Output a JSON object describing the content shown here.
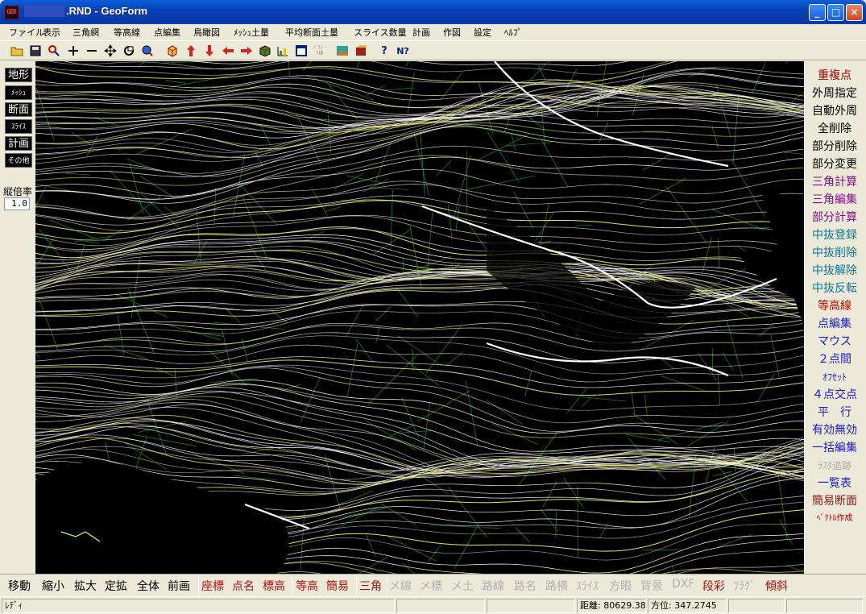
{
  "window": {
    "title": ".RND - GeoForm",
    "icon_text": "GEO",
    "buttons": {
      "minimize": "_",
      "maximize": "□",
      "close": "×"
    }
  },
  "menu": [
    "ファイル",
    "表示",
    "三角網",
    "等高線",
    "点編集",
    "鳥瞰図",
    "ﾒｯｼｭ土量",
    "平均断面土量",
    "スライス数量",
    "計画",
    "作図",
    "設定",
    "ﾍﾙﾌﾟ"
  ],
  "toolbar": [
    {
      "icon": "open-folder-icon"
    },
    {
      "icon": "save-icon"
    },
    {
      "icon": "zoom-icon"
    },
    {
      "icon": "plus-icon"
    },
    {
      "icon": "minus-icon"
    },
    {
      "icon": "move-icon"
    },
    {
      "icon": "rotate-icon"
    },
    {
      "icon": "zoom-refresh-icon"
    },
    {
      "icon": "cube-icon"
    },
    {
      "icon": "arrow-up-icon"
    },
    {
      "icon": "arrow-down-icon"
    },
    {
      "icon": "arrow-left-icon"
    },
    {
      "icon": "arrow-right-icon"
    },
    {
      "icon": "box-3d-icon"
    },
    {
      "icon": "chart-icon"
    },
    {
      "icon": "window-icon"
    },
    {
      "icon": "setting-disabled-icon",
      "label": "ﾊﾟﾗﾒ ｰﾀ確"
    },
    {
      "icon": "terrain-icon"
    },
    {
      "icon": "volume-icon"
    },
    {
      "icon": "help-icon",
      "label": "?"
    },
    {
      "icon": "context-help-icon",
      "label": "N?"
    }
  ],
  "left_panel": {
    "buttons": [
      "地形",
      "ﾒｯｼｭ",
      "断面",
      "ｽﾗｲｽ",
      "計画",
      "その他"
    ],
    "ratio_label": "縦倍率",
    "ratio_value": "1.0"
  },
  "right_panel": [
    {
      "label": "重複点",
      "color": "#a00000"
    },
    {
      "label": "外周指定",
      "color": "#000000"
    },
    {
      "label": "自動外周",
      "color": "#000000"
    },
    {
      "label": "全削除",
      "color": "#000000"
    },
    {
      "label": "部分削除",
      "color": "#000000"
    },
    {
      "label": "部分変更",
      "color": "#000000"
    },
    {
      "label": "三角計算",
      "color": "#8b0a8b"
    },
    {
      "label": "三角編集",
      "color": "#8b0a8b"
    },
    {
      "label": "部分計算",
      "color": "#8b0a8b"
    },
    {
      "label": "中抜登録",
      "color": "#0a7a9b"
    },
    {
      "label": "中抜削除",
      "color": "#0a7a9b"
    },
    {
      "label": "中抜解除",
      "color": "#0a7a9b"
    },
    {
      "label": "中抜反転",
      "color": "#0a7a9b"
    },
    {
      "label": "等高線",
      "color": "#c00000"
    },
    {
      "label": "点編集",
      "color": "#1a1acc"
    },
    {
      "label": "マウス",
      "color": "#1a1acc"
    },
    {
      "label": "２点間",
      "color": "#1a1acc"
    },
    {
      "label": "ｵﾌｾｯﾄ",
      "color": "#1a1acc"
    },
    {
      "label": "４点交点",
      "color": "#1a1acc"
    },
    {
      "label": "平　行",
      "color": "#1a1acc"
    },
    {
      "label": "有効無効",
      "color": "#1a1acc"
    },
    {
      "label": "一括編集",
      "color": "#1a1acc"
    },
    {
      "label": "ﾗｽﾀ追跡",
      "color": "#a8a8a8"
    },
    {
      "label": "一覧表",
      "color": "#1a1acc"
    },
    {
      "label": "簡易断面",
      "color": "#8b1a1a"
    },
    {
      "label": "ﾍﾞｸﾄﾙ作成",
      "color": "#c00000"
    }
  ],
  "bottom_bar": [
    {
      "label": "移動",
      "color": "#000000"
    },
    {
      "label": "縮小",
      "color": "#000000"
    },
    {
      "label": "拡大",
      "color": "#000000"
    },
    {
      "label": "定拡",
      "color": "#000000"
    },
    {
      "label": "全体",
      "color": "#000000"
    },
    {
      "label": "前画",
      "color": "#000000"
    },
    {
      "label": "座標",
      "color": "#b01010"
    },
    {
      "label": "点名",
      "color": "#b01010"
    },
    {
      "label": "標高",
      "color": "#b01010"
    },
    {
      "label": "等高",
      "color": "#b01010"
    },
    {
      "label": "簡易",
      "color": "#b01010"
    },
    {
      "label": "三角",
      "color": "#b01010"
    },
    {
      "label": "メ線",
      "color": "#b0b0b0"
    },
    {
      "label": "メ標",
      "color": "#b0b0b0"
    },
    {
      "label": "メ土",
      "color": "#b0b0b0"
    },
    {
      "label": "路線",
      "color": "#b0b0b0"
    },
    {
      "label": "路名",
      "color": "#b0b0b0"
    },
    {
      "label": "路横",
      "color": "#b0b0b0"
    },
    {
      "label": "ｽﾗｲｽ",
      "color": "#b0b0b0"
    },
    {
      "label": "方眼",
      "color": "#b0b0b0"
    },
    {
      "label": "背景",
      "color": "#b0b0b0"
    },
    {
      "label": "DXF",
      "color": "#b0b0b0"
    },
    {
      "label": "段彩",
      "color": "#b01010"
    },
    {
      "label": "ﾌﾗｸﾞ",
      "color": "#b0b0b0"
    },
    {
      "label": "傾斜",
      "color": "#b01010"
    }
  ],
  "status": {
    "ready": "ﾚﾃﾞｨ",
    "distance_label": "距離:",
    "distance_value": "80629.384",
    "bearing_label": "方位:",
    "bearing_value": "347.2745"
  },
  "colors": {
    "contour_white": "#ffffff",
    "contour_yellow": "#f0f060",
    "triangle_green": "#1f7a1f",
    "canvas_bg": "#000000"
  }
}
